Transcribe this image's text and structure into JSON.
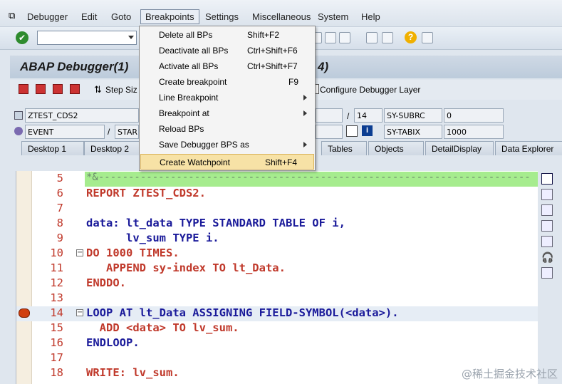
{
  "menubar": {
    "items": [
      "Debugger",
      "Edit",
      "Goto",
      "Breakpoints",
      "Settings",
      "Miscellaneous",
      "System",
      "Help"
    ]
  },
  "title": {
    "left": "ABAP Debugger(1)",
    "right": "4)"
  },
  "app_toolbar": {
    "step_size": "Step Siz",
    "configure": "Configure Debugger Layer"
  },
  "info": {
    "program": "ZTEST_CDS2",
    "event": "EVENT",
    "event_value": "STAR",
    "line": "14",
    "sy_subrc_label": "SY-SUBRC",
    "sy_subrc_value": "0",
    "sy_tabix_label": "SY-TABIX",
    "sy_tabix_value": "1000"
  },
  "tabs": [
    "Desktop 1",
    "Desktop 2",
    "Tables",
    "Objects",
    "DetailDisplay",
    "Data Explorer"
  ],
  "breakpoints_menu": [
    {
      "label": "Delete all BPs",
      "shortcut": "Shift+F2",
      "submenu": false
    },
    {
      "label": "Deactivate all BPs",
      "shortcut": "Ctrl+Shift+F6",
      "submenu": false
    },
    {
      "label": "Activate all BPs",
      "shortcut": "Ctrl+Shift+F7",
      "submenu": false
    },
    {
      "label": "Create breakpoint",
      "shortcut": "F9",
      "submenu": false
    },
    {
      "label": "Line Breakpoint",
      "shortcut": "",
      "submenu": true
    },
    {
      "label": "Breakpoint at",
      "shortcut": "",
      "submenu": true
    },
    {
      "label": "Reload BPs",
      "shortcut": "",
      "submenu": false
    },
    {
      "label": "Save Debugger BPS as",
      "shortcut": "",
      "submenu": true
    },
    {
      "label": "Create Watchpoint",
      "shortcut": "Shift+F4",
      "submenu": false,
      "highlighted": true
    }
  ],
  "code_lines": [
    {
      "n": "5",
      "text": "*&------------------------------------------------------------------------"
    },
    {
      "n": "6",
      "text": "REPORT ZTEST_CDS2."
    },
    {
      "n": "7",
      "text": ""
    },
    {
      "n": "8",
      "text": "data: lt_data TYPE STANDARD TABLE OF i,"
    },
    {
      "n": "9",
      "text": "      lv_sum TYPE i."
    },
    {
      "n": "10",
      "text": "DO 1000 TIMES."
    },
    {
      "n": "11",
      "text": "   APPEND sy-index TO lt_Data."
    },
    {
      "n": "12",
      "text": "ENDDO."
    },
    {
      "n": "13",
      "text": ""
    },
    {
      "n": "14",
      "text": "LOOP AT lt_Data ASSIGNING FIELD-SYMBOL(<data>)."
    },
    {
      "n": "15",
      "text": "  ADD <data> TO lv_sum."
    },
    {
      "n": "16",
      "text": "ENDLOOP."
    },
    {
      "n": "17",
      "text": ""
    },
    {
      "n": "18",
      "text": "WRITE: lv_sum."
    }
  ],
  "watermark": "@稀土掘金技术社区",
  "colors": {
    "comment_line_bg": "#a6ec8e",
    "current_line_bg": "#e6edf5",
    "menu_highlight": "#f7e2a6",
    "keyword": "#c0392b",
    "identifier": "#1a1a9a"
  }
}
